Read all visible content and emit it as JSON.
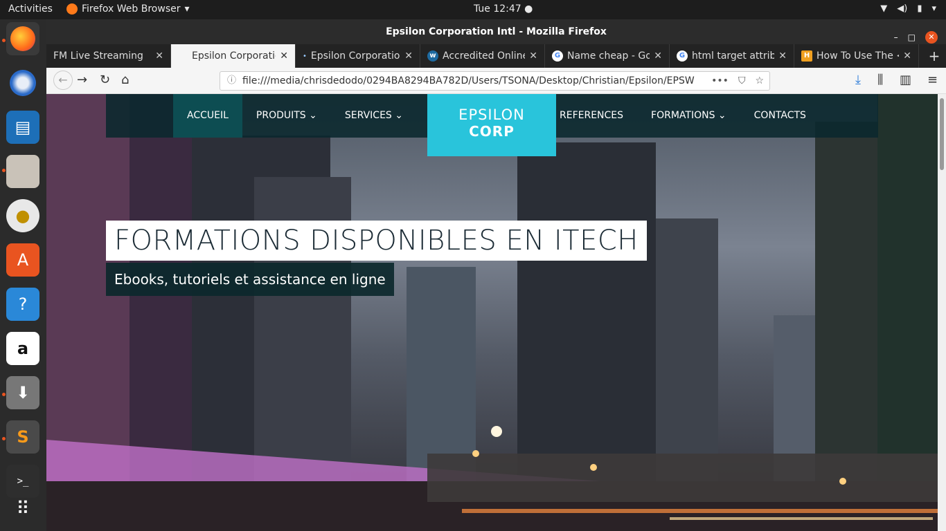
{
  "topbar": {
    "activities": "Activities",
    "app": "Firefox Web Browser",
    "clock": "Tue 12:47 ●"
  },
  "dock": {
    "items": [
      "firefox-icon",
      "thunderbird-icon",
      "libreoffice-impress-icon",
      "files-icon",
      "rhythmbox-icon",
      "software-center-icon",
      "help-icon",
      "amazon-icon",
      "installer-icon",
      "sublime-text-icon",
      "terminal-icon",
      "app-grid-icon"
    ]
  },
  "window": {
    "title": "Epsilon Corporation Intl - Mozilla Firefox"
  },
  "tabs": [
    {
      "label": "FM Live Streaming"
    },
    {
      "label": "Epsilon Corporation"
    },
    {
      "label": "Epsilon Corporation"
    },
    {
      "label": "Accredited Online"
    },
    {
      "label": "Name cheap - Goo"
    },
    {
      "label": "html target attrib"
    },
    {
      "label": "How To Use The <a"
    }
  ],
  "url": "file:///media/chrisdedodo/0294BA8294BA782D/Users/TSONA/Desktop/Christian/Epsilon/EPSW",
  "site": {
    "menu": {
      "accueil": "ACCUEIL",
      "produits": "PRODUITS",
      "services": "SERVICES",
      "references": "REFERENCES",
      "formations": "FORMATIONS",
      "contacts": "CONTACTS"
    },
    "logo": {
      "line1": "EPSILON",
      "line2": "CORP"
    },
    "hero_title": "FORMATIONS DISPONIBLES EN ITECH",
    "hero_subtitle": "Ebooks, tutoriels et assistance en ligne"
  }
}
